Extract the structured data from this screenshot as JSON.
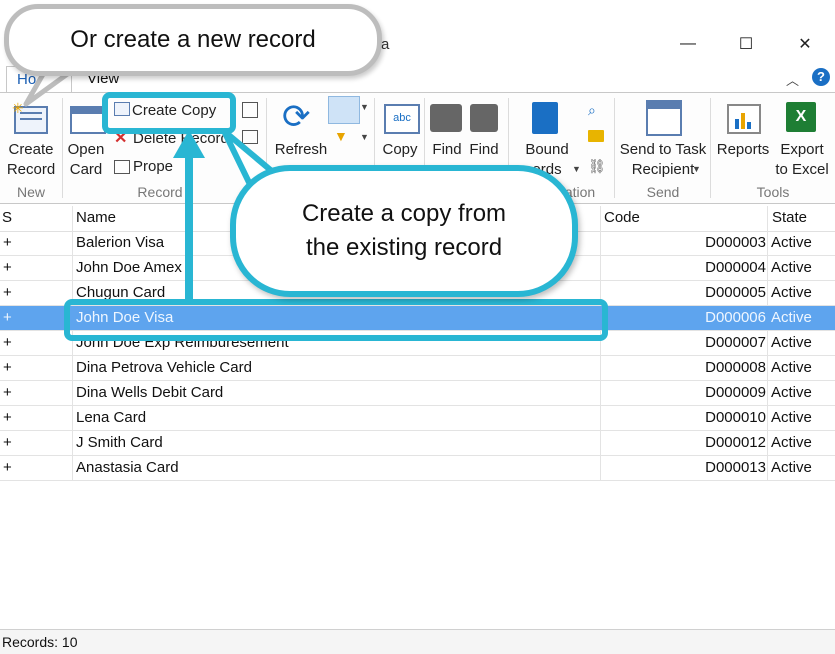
{
  "window": {
    "title_fragment": "ra",
    "controls": {
      "minimize": "—",
      "maximize": "☐",
      "close": "✕"
    }
  },
  "tabs": [
    {
      "label": "Ho"
    },
    {
      "label": "View"
    }
  ],
  "ribbon": {
    "new_group": {
      "label": "New",
      "create_record": "Create\nRecord"
    },
    "record_group": {
      "label": "Record",
      "open_card": "Open\nCard",
      "create_copy": "Create Copy",
      "delete_record": "Delete Record",
      "properties": "Prope"
    },
    "refresh": "Refresh",
    "copy": "Copy",
    "find1": "Find",
    "find2": "Find",
    "bound_records": "Bound\nords",
    "navigation_label": "ation",
    "send_group": {
      "label": "Send",
      "send_to_task": "Send to Task\nRecipient"
    },
    "tools_group": {
      "label": "Tools",
      "reports": "Reports",
      "export_excel": "Export\nto Excel"
    }
  },
  "grid": {
    "columns": {
      "s": "S",
      "name": "Name",
      "code": "Code",
      "state": "State"
    },
    "rows": [
      {
        "s": "+",
        "name": "Balerion Visa",
        "code": "D000003",
        "state": "Active"
      },
      {
        "s": "+",
        "name": "John Doe Amex",
        "code": "D000004",
        "state": "Active"
      },
      {
        "s": "+",
        "name": "Chugun Card",
        "code": "D000005",
        "state": "Active"
      },
      {
        "s": "+",
        "name": "John Doe Visa",
        "code": "D000006",
        "state": "Active"
      },
      {
        "s": "+",
        "name": "John Doe Exp Reimburesement",
        "code": "D000007",
        "state": "Active"
      },
      {
        "s": "+",
        "name": "Dina Petrova Vehicle Card",
        "code": "D000008",
        "state": "Active"
      },
      {
        "s": "+",
        "name": "Dina Wells Debit Card",
        "code": "D000009",
        "state": "Active"
      },
      {
        "s": "+",
        "name": "Lena Card",
        "code": "D000010",
        "state": "Active"
      },
      {
        "s": "+",
        "name": "J Smith Card",
        "code": "D000012",
        "state": "Active"
      },
      {
        "s": "+",
        "name": "Anastasia Card",
        "code": "D000013",
        "state": "Active"
      }
    ]
  },
  "status": {
    "records": "Records: 10"
  },
  "callouts": {
    "top": "Or create a new record",
    "copy_line1": "Create a copy from",
    "copy_line2": "the existing record"
  },
  "colors": {
    "accent": "#29b6d3",
    "selection": "#5ea4ee",
    "ribbon_blue": "#1a6fc4"
  }
}
